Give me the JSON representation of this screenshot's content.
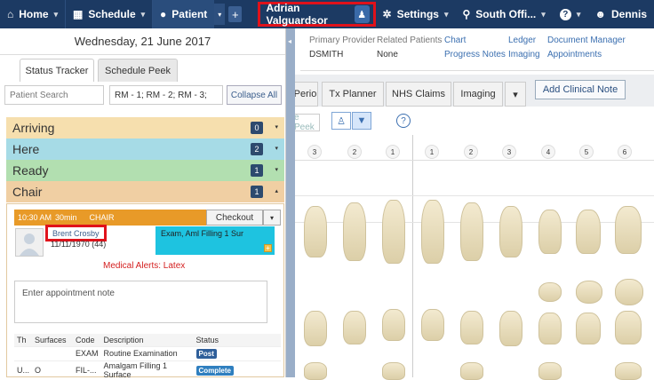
{
  "topnav": {
    "home": "Home",
    "schedule": "Schedule",
    "patient": "Patient",
    "patient_name": "Adrian Valguardsor",
    "settings": "Settings",
    "office": "South Offi...",
    "help": "?",
    "user": "Dennis"
  },
  "infobar": {
    "primary_provider_label": "Primary Provider",
    "primary_provider": "DSMITH",
    "related_label": "Related Patients",
    "related": "None",
    "links": [
      "Chart",
      "Ledger",
      "Document Manager",
      "Progress Notes",
      "Imaging",
      "Appointments"
    ]
  },
  "tabs": [
    "Perio",
    "Tx Planner",
    "NHS Claims",
    "Imaging"
  ],
  "add_clinical_note": "Add Clinical Note",
  "toolbar": {
    "peek": "e Peek"
  },
  "tooth_numbers": [
    "3",
    "2",
    "1",
    "1",
    "2",
    "3",
    "4",
    "5",
    "6"
  ],
  "panel": {
    "date": "Wednesday, 21 June 2017",
    "tab1": "Status Tracker",
    "tab2": "Schedule Peek",
    "search_placeholder": "Patient Search",
    "rooms": "RM - 1; RM - 2; RM - 3;",
    "collapse": "Collapse All"
  },
  "sections": [
    {
      "name": "Arriving",
      "count": "0"
    },
    {
      "name": "Here",
      "count": "2"
    },
    {
      "name": "Ready",
      "count": "1"
    },
    {
      "name": "Chair",
      "count": "1"
    }
  ],
  "appointment": {
    "time": "10:30 AM",
    "duration": "30min",
    "room": "CHAIR",
    "checkout": "Checkout",
    "patient": "Brent Crosby",
    "dob": "11/11/1970",
    "age": "(44)",
    "procedures": "Exam, Aml Filling 1 Sur",
    "alert": "Medical Alerts: Latex",
    "note_placeholder": "Enter appointment note"
  },
  "table": {
    "headers": [
      "Th",
      "Surfaces",
      "Code",
      "Description",
      "Status"
    ],
    "rows": [
      {
        "th": "",
        "surfaces": "",
        "code": "EXAM",
        "desc": "Routine Examination",
        "status": "Post"
      },
      {
        "th": "U...",
        "surfaces": "O",
        "code": "FIL-...",
        "desc": "Amalgam Filling 1 Surface",
        "status": "Complete"
      }
    ]
  },
  "colors": {
    "nav": "#1c3a63",
    "arriving": "#f6dfae",
    "here": "#a6dbe6",
    "ready": "#b2dfb0",
    "chair": "#f0cfa3",
    "highlight": "#e0121b"
  }
}
